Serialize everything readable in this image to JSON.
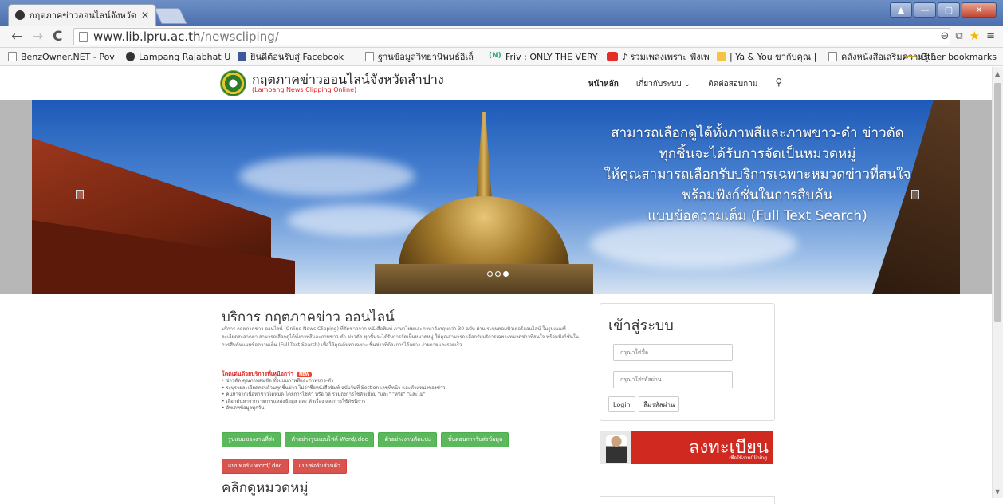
{
  "browser": {
    "tab_title": "กฤตภาคข่าวออนไลน์จังหวัดลำ",
    "tab_close": "✕",
    "url_host": "www.lib.lpru.ac.th",
    "url_path": "/newscliping/",
    "window_buttons": [
      "▲",
      "—",
      "▢",
      "✕"
    ],
    "bookmarks": [
      {
        "label": "BenzOwner.NET - Pov",
        "icon": "page"
      },
      {
        "label": "Lampang Rajabhat Ur",
        "icon": "dark"
      },
      {
        "label": "ยินดีต้อนรับสู่ Facebook",
        "icon": "fb"
      },
      {
        "label": "ฐานข้อมูลวิทยานิพนธ์อิเล็",
        "icon": "page"
      },
      {
        "label": "Friv : ONLY THE VERY",
        "icon": "friv"
      },
      {
        "label": "♪ รวมเพลงเพราะ ฟังเพล",
        "icon": "yt"
      },
      {
        "label": "| Ya & You ขากับคุณ | ส",
        "icon": "yellow"
      },
      {
        "label": "คลังหนังสือเสริมความรู้ 1",
        "icon": "page"
      }
    ],
    "bookmarks_more": "»",
    "other_bookmarks": "Other bookmarks"
  },
  "site": {
    "title": "กฤตภาคข่าวออนไลน์จังหวัดลำปาง",
    "subtitle": "(Lampang News Clipping Online)",
    "nav": [
      "หน้าหลัก",
      "เกี่ยวกับระบบ ⌄",
      "ติดต่อสอบถาม"
    ],
    "search_icon": "⚲"
  },
  "hero": {
    "lines": [
      "สามารถเลือกดูได้ทั้งภาพสีและภาพขาว-ดำ ข่าวตัด",
      "ทุกชิ้นจะได้รับการจัดเป็นหมวดหมู่",
      "ให้คุณสามารถเลือกรับบริการเฉพาะหมวดข่าวที่สนใจ",
      "พร้อมฟังก์ชั่นในการสืบค้น",
      "แบบข้อความเต็ม (Full Text Search)"
    ],
    "slide_count": 3,
    "active_slide": 3
  },
  "main": {
    "title": "บริการ กฤตภาคข่าว ออนไลน์",
    "description": "บริการ กฤตภาคข่าว ออนไลน์ (Online News Clipping) ที่ตัดข่าวจาก หนังสือพิมพ์ ภาษาไทยและภาษาอังกฤษกว่า 30 ฉบับ ผ่าน ระบบคอมพิวเตอร์ออนไลน์ ในรูปแบบที่ละเอียดสะอาดตา สามารถเลือกดูได้ทั้งภาพสีและภาพขาว-ดำ ข่าวตัด ทุกชิ้นจะได้รับการจัดเป็นหมวดหมู่ ให้คุณสามารถ เลือกรับบริการเฉพาะหมวดข่าวที่สนใจ พร้อมฟังก์ชั่นในการสืบค้นแบบข้อความเต็ม (Full Text Search) เพื่อให้คุณค้นหาเฉพาะ ชิ้นข่าวที่ต้องการได้อย่าง ง่ายดายและรวดเร็ว",
    "features_title": "โดดเด่นด้วยบริการที่เหนือกว่า",
    "features_badge": "NEW",
    "features": [
      "• ข่าวตัด คุณภาพคมชัด ทั้งแบบภาพสีและภาพขาว-ดำ",
      "• ระบุรายละเอียดครบถ้วนทุกชิ้นข่าว ไม่ว่าชื่อหนังสือพิมพ์ ฉบับวันที่ Section เลขที่หน้า และตำแหน่งของข่าว",
      "• ค้นหาจากเนื้อหาข่าวได้หมด โดยการใช้คำ หรือ วลี รวมถึงการใช้ตัวเชื่อม \"และ\" \"หรือ\" \"และไม่\"",
      "• เลือกค้นหาจากรายการแหล่งข้อมูล และ หัวเรื่อง และการใช้ดัชนีการ",
      "• อัพเดทข้อมูลทุกวัน"
    ],
    "green_buttons": [
      "รูปแบบของงานที่ส่ง",
      "ตัวอย่างรูปแบบไฟล์ Word/.doc",
      "ตัวอย่างงานตัดแปะ",
      "ขั้นตอนการรับส่งข้อมูล"
    ],
    "red_buttons": [
      "แบบฟอร์ม word/.doc",
      "แบบฟอร์มส่วนตัว"
    ],
    "category_title": "คลิกดูหมวดหมู่"
  },
  "login": {
    "title": "เข้าสู่ระบบ",
    "username_placeholder": "กรุณาใส่ชื่อ",
    "password_placeholder": "กรุณาใส่รหัสผ่าน",
    "login_label": "Login",
    "forgot_label": "ลืมรหัสผ่าน"
  },
  "register_banner": {
    "text": "ลงทะเบียน",
    "subtext": "เพื่อใช้งานCliping"
  },
  "colors": {
    "green_button": "#5cb85c",
    "red_button": "#d9534f",
    "subtitle_red": "#dd2222"
  }
}
